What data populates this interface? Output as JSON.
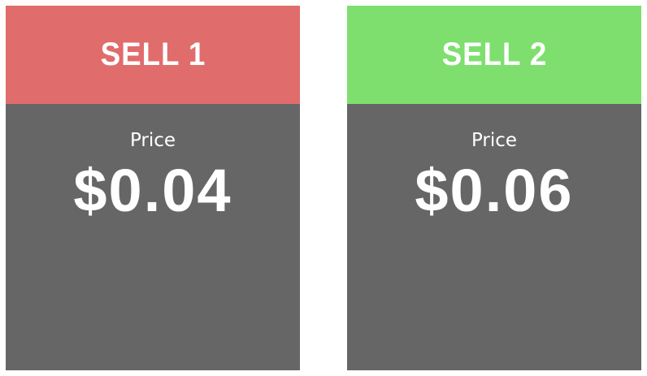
{
  "cards": [
    {
      "title": "SELL 1",
      "price_label": "Price",
      "price": "$0.04",
      "header_color": "#e06c6c"
    },
    {
      "title": "SELL 2",
      "price_label": "Price",
      "price": "$0.06",
      "header_color": "#7edf6f"
    }
  ],
  "colors": {
    "card_body": "#666666",
    "text": "#ffffff"
  }
}
